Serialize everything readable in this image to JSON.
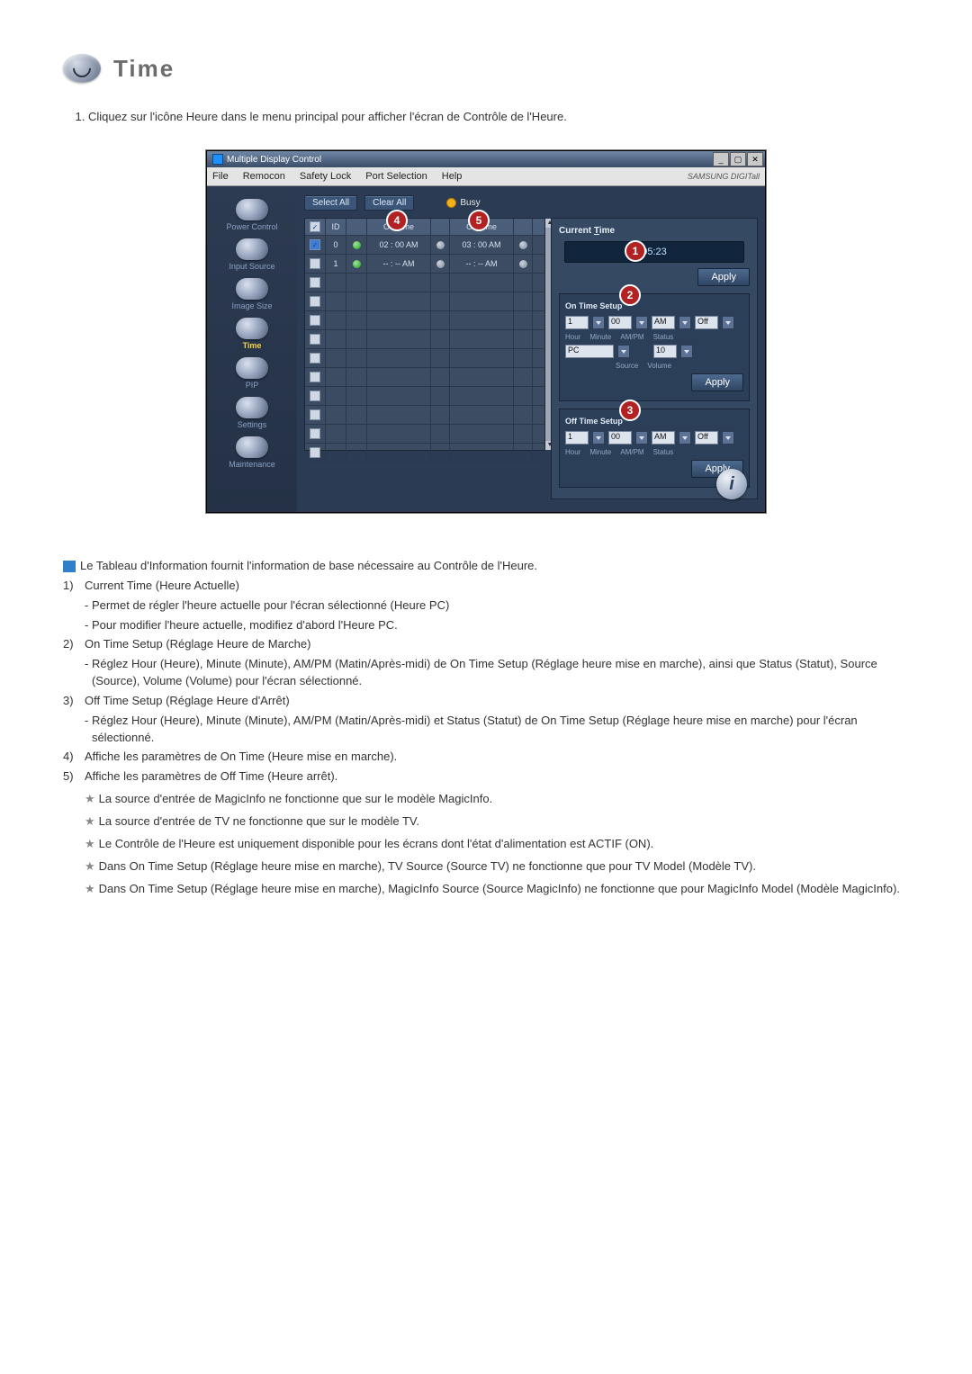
{
  "page": {
    "title": "Time"
  },
  "intro": {
    "list_item_1": "Cliquez sur l'icône Heure dans le menu principal pour afficher l'écran de Contrôle de l'Heure."
  },
  "app": {
    "title": "Multiple Display Control",
    "brand": "SAMSUNG DIGITall",
    "menu": {
      "file": "File",
      "remocon": "Remocon",
      "safety": "Safety Lock",
      "port": "Port Selection",
      "help": "Help"
    },
    "sidebar": {
      "items": [
        {
          "label": "Power Control"
        },
        {
          "label": "Input Source"
        },
        {
          "label": "Image Size"
        },
        {
          "label": "Time"
        },
        {
          "label": "PIP"
        },
        {
          "label": "Settings"
        },
        {
          "label": "Maintenance"
        }
      ]
    },
    "toolbar": {
      "select_all": "Select All",
      "clear_all": "Clear All",
      "busy": "Busy"
    },
    "grid": {
      "headers": {
        "chk": "",
        "id": "ID",
        "st": "",
        "on": "On Time",
        "dot": "",
        "off": "Off Time",
        "dot2": ""
      },
      "rows": [
        {
          "checked": true,
          "blue": true,
          "id": "0",
          "led": "on",
          "on": "02 : 00  AM",
          "off": "03 : 00  AM",
          "d1": "on",
          "d2": "on"
        },
        {
          "checked": false,
          "blue": false,
          "id": "1",
          "led": "on",
          "on": "-- : --  AM",
          "off": "-- : --  AM",
          "d1": "gray",
          "d2": "gray"
        },
        {
          "checked": false
        },
        {
          "checked": false
        },
        {
          "checked": false
        },
        {
          "checked": false
        },
        {
          "checked": false
        },
        {
          "checked": false
        },
        {
          "checked": false
        },
        {
          "checked": false
        },
        {
          "checked": false
        },
        {
          "checked": false
        }
      ]
    },
    "panel": {
      "current_time_title_pre": "Current ",
      "current_time_title_u": "T",
      "current_time_title_post": "ime",
      "clock": "05:23",
      "apply": "Apply",
      "on_title": "On Time Setup",
      "off_title": "Off Time Setup",
      "hour": "1",
      "min": "00",
      "ampm": "AM",
      "status": "Off",
      "src": "PC",
      "vol": "10",
      "labels": {
        "hour": "Hour",
        "minute": "Minute",
        "ampm": "AM/PM",
        "status": "Status",
        "source": "Source",
        "volume": "Volume"
      }
    }
  },
  "desc": {
    "lead": "Le Tableau d'Information fournit l'information de base nécessaire au Contrôle de l'Heure.",
    "n1": "1)",
    "t1": "Current Time (Heure Actuelle)",
    "t1a": "Permet de régler l'heure actuelle pour l'écran sélectionné (Heure PC)",
    "t1b": "Pour modifier l'heure actuelle, modifiez d'abord l'Heure PC.",
    "n2": "2)",
    "t2": "On Time Setup (Réglage Heure de Marche)",
    "t2a": "Réglez Hour (Heure), Minute (Minute), AM/PM (Matin/Après-midi) de On Time Setup (Réglage heure mise en marche), ainsi que Status (Statut), Source (Source), Volume (Volume) pour l'écran sélectionné.",
    "n3": "3)",
    "t3": "Off Time Setup (Réglage Heure d'Arrêt)",
    "t3a": "Réglez Hour (Heure), Minute (Minute), AM/PM (Matin/Après-midi) et Status (Statut) de On Time Setup (Réglage heure mise en marche) pour l'écran sélectionné.",
    "n4": "4)",
    "t4": "Affiche les paramètres de On Time (Heure mise en marche).",
    "n5": "5)",
    "t5": "Affiche les paramètres de Off Time (Heure arrêt).",
    "s1": "La source d'entrée de MagicInfo ne fonctionne que sur le modèle MagicInfo.",
    "s2": "La source d'entrée de TV ne fonctionne que sur le modèle TV.",
    "s3": "Le Contrôle de l'Heure est uniquement disponible pour les écrans dont l'état d'alimentation est ACTIF (ON).",
    "s4": "Dans On Time Setup (Réglage heure mise en marche), TV Source (Source TV) ne fonctionne que pour TV Model (Modèle TV).",
    "s5": "Dans On Time Setup (Réglage heure mise en marche), MagicInfo Source (Source MagicInfo) ne fonctionne que pour MagicInfo Model (Modèle MagicInfo)."
  }
}
